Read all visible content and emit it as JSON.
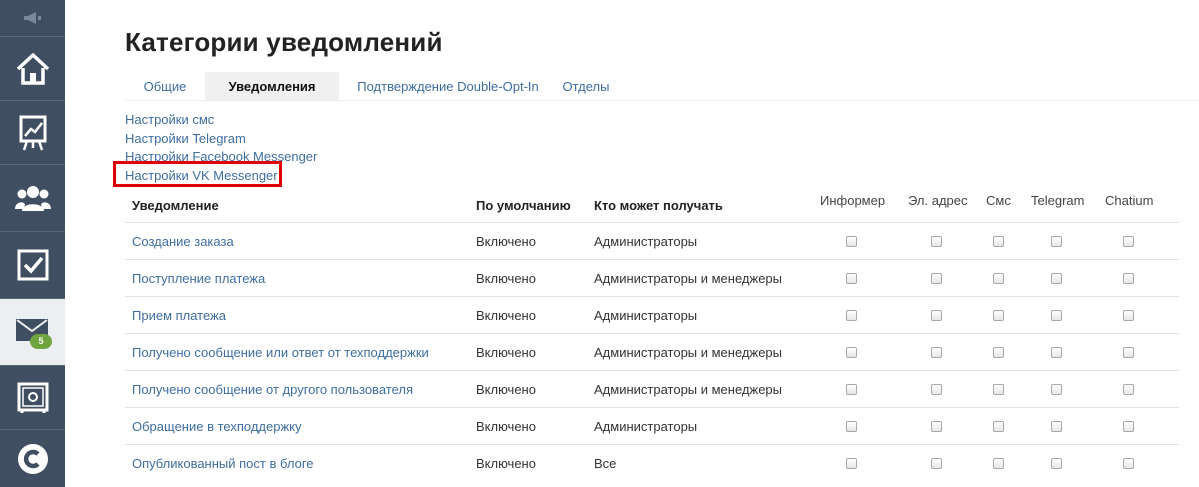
{
  "sidebar": {
    "items": [
      {
        "icon": "megaphone-icon"
      },
      {
        "icon": "home-icon"
      },
      {
        "icon": "chart-board-icon"
      },
      {
        "icon": "users-icon"
      },
      {
        "icon": "checkbox-icon"
      },
      {
        "icon": "mail-icon",
        "badge": "5",
        "active": true
      },
      {
        "icon": "safe-icon"
      },
      {
        "icon": "chatium-logo-icon"
      }
    ],
    "bg_color": "#404e62",
    "badge_color": "#6ea33f"
  },
  "page": {
    "title": "Категории уведомлений"
  },
  "tabs": [
    {
      "label": "Общие",
      "active": false
    },
    {
      "label": "Уведомления",
      "active": true
    },
    {
      "label": "Подтверждение Double-Opt-In",
      "active": false
    },
    {
      "label": "Отделы",
      "active": false
    }
  ],
  "settings_links": [
    {
      "label": "Настройки смс"
    },
    {
      "label": "Настройки Telegram"
    },
    {
      "label": "Настройки Facebook Messenger"
    },
    {
      "label": "Настройки VK Messenger",
      "highlighted": true
    }
  ],
  "table": {
    "headers": {
      "notification": "Уведомление",
      "default": "По умолчанию",
      "who": "Кто может получать",
      "channels": [
        "Информер",
        "Эл. адрес",
        "Смс",
        "Telegram",
        "Chatium"
      ]
    },
    "rows": [
      {
        "name": "Создание заказа",
        "default": "Включено",
        "who": "Администраторы",
        "checks": [
          false,
          false,
          false,
          false,
          false
        ]
      },
      {
        "name": "Поступление платежа",
        "default": "Включено",
        "who": "Администраторы и менеджеры",
        "checks": [
          false,
          false,
          false,
          false,
          false
        ]
      },
      {
        "name": "Прием платежа",
        "default": "Включено",
        "who": "Администраторы",
        "checks": [
          false,
          false,
          false,
          false,
          false
        ]
      },
      {
        "name": "Получено сообщение или ответ от техподдержки",
        "default": "Включено",
        "who": "Администраторы и менеджеры",
        "checks": [
          false,
          false,
          false,
          false,
          false
        ]
      },
      {
        "name": "Получено сообщение от другого пользователя",
        "default": "Включено",
        "who": "Администраторы и менеджеры",
        "checks": [
          false,
          false,
          false,
          false,
          false
        ]
      },
      {
        "name": "Обращение в техподдержку",
        "default": "Включено",
        "who": "Администраторы",
        "checks": [
          false,
          false,
          false,
          false,
          false
        ]
      },
      {
        "name": "Опубликованный пост в блоге",
        "default": "Включено",
        "who": "Все",
        "checks": [
          false,
          false,
          false,
          false,
          false
        ]
      }
    ]
  },
  "colors": {
    "link": "#3e6ea0",
    "highlight": "#e00000"
  }
}
